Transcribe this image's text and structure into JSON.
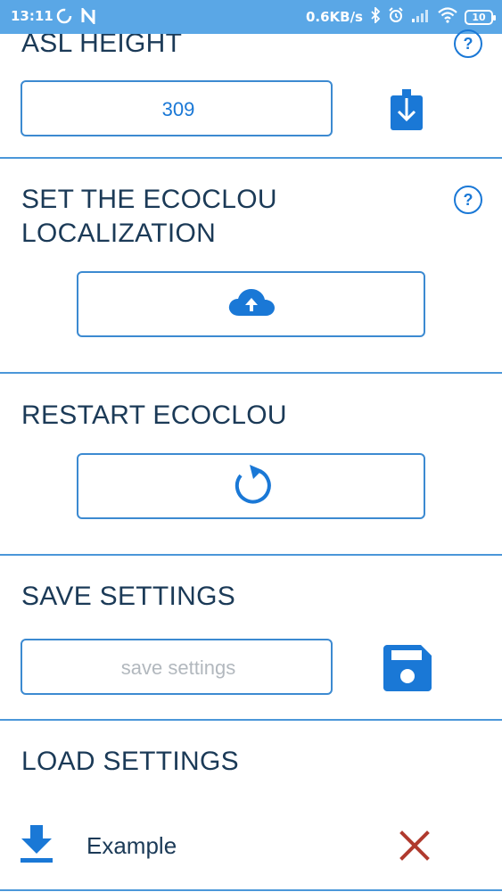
{
  "status_bar": {
    "time": "13:11",
    "network_speed": "0.6KB/s",
    "battery_level": "10",
    "icons": [
      "sync-icon",
      "n-icon",
      "bluetooth-icon",
      "alarm-icon",
      "signal-icon",
      "wifi-icon",
      "battery-icon"
    ]
  },
  "asl_height": {
    "title": "ASL HEIGHT",
    "value": "309",
    "help_symbol": "?"
  },
  "localization": {
    "title_line1": "SET THE ECOCLOU",
    "title_line2": "LOCALIZATION",
    "help_symbol": "?"
  },
  "restart": {
    "title": "RESTART ECOCLOU"
  },
  "save_settings": {
    "title": "SAVE SETTINGS",
    "placeholder": "save settings"
  },
  "load_settings": {
    "title": "LOAD SETTINGS",
    "items": [
      {
        "name": "Example"
      }
    ]
  },
  "colors": {
    "accent": "#1a78d6",
    "border": "#3c8ad1",
    "status_bar": "#5aa7e6",
    "text": "#1b3a57",
    "delete": "#b03a2e"
  }
}
